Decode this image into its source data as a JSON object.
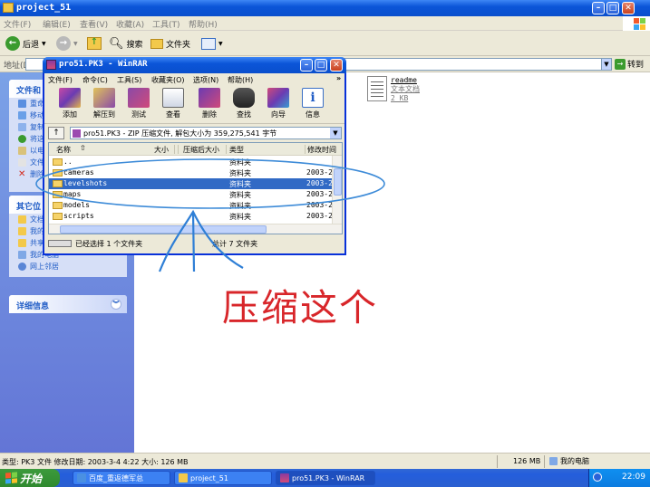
{
  "explorer": {
    "title": "project_51",
    "menu": [
      "文件(F)",
      "编辑(E)",
      "查看(V)",
      "收藏(A)",
      "工具(T)",
      "帮助(H)"
    ],
    "toolbar": {
      "back": "后退",
      "search": "搜索",
      "folders": "文件夹"
    },
    "address_label": "地址(D)",
    "go_label": "转到",
    "left_panels": {
      "file_tasks": {
        "title": "文件和",
        "items": [
          "重命",
          "移动",
          "复制",
          "将这",
          "以电",
          "文件",
          "删除"
        ]
      },
      "other_places": {
        "title": "其它位",
        "items": [
          "文档",
          "我的",
          "共享",
          "我的电脑",
          "网上邻居"
        ]
      },
      "details": {
        "title": "详细信息"
      }
    },
    "files": [
      {
        "name": "readme",
        "type": "文本文档",
        "size": "2 KB"
      }
    ],
    "status": {
      "info": "类型: PK3 文件 修改日期: 2003-3-4 4:22 大小: 126 MB",
      "size": "126 MB",
      "location": "我的电脑"
    }
  },
  "winrar": {
    "title": "pro51.PK3 - WinRAR",
    "menu": [
      "文件(F)",
      "命令(C)",
      "工具(S)",
      "收藏夹(O)",
      "选项(N)",
      "帮助(H)"
    ],
    "tools": [
      "添加",
      "解压到",
      "测试",
      "查看",
      "删除",
      "查找",
      "向导",
      "信息"
    ],
    "path_text": "pro51.PK3 - ZIP 压缩文件, 解包大小为 359,275,541 字节",
    "columns": [
      "名称",
      "大小",
      "压缩后大小",
      "类型",
      "修改时间"
    ],
    "rows": [
      {
        "name": "..",
        "type": "资料夹",
        "date": ""
      },
      {
        "name": "cameras",
        "type": "资料夹",
        "date": "2003-2-"
      },
      {
        "name": "levelshots",
        "type": "资料夹",
        "date": "2003-2-"
      },
      {
        "name": "maps",
        "type": "资料夹",
        "date": "2003-2-"
      },
      {
        "name": "models",
        "type": "资料夹",
        "date": "2003-2-"
      },
      {
        "name": "scripts",
        "type": "资料夹",
        "date": "2003-2-"
      }
    ],
    "status_left": "已经选择 1 个文件夹",
    "status_right": "总计 7 文件夹"
  },
  "taskbar": {
    "start": "开始",
    "tasks": [
      "百度_重返德军总",
      "project_51",
      "pro51.PK3 - WinRAR"
    ],
    "clock": "22:09"
  },
  "annotation": {
    "text": "压缩这个",
    "color": "#d8262a"
  }
}
